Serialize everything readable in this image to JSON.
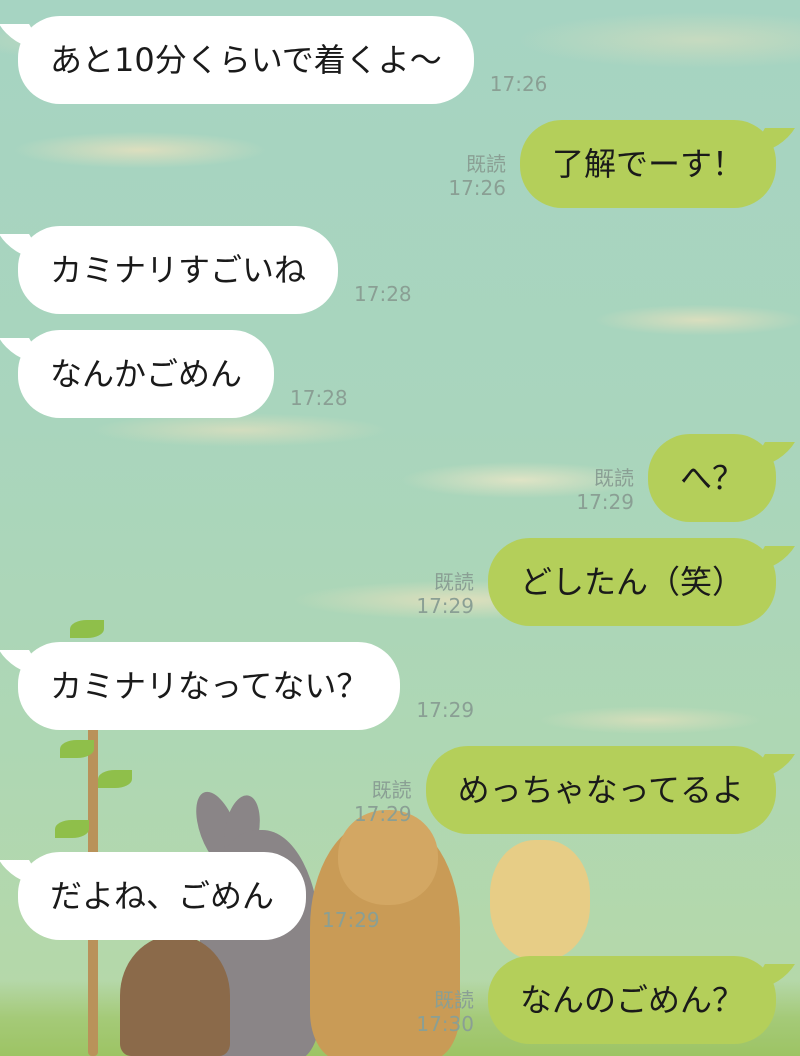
{
  "chat": {
    "messages": [
      {
        "side": "in",
        "text": "あと10分くらいで着くよ〜",
        "time": "17:26"
      },
      {
        "side": "out",
        "text": "了解でーす！",
        "time": "17:26",
        "read": "既読"
      },
      {
        "side": "in",
        "text": "カミナリすごいね",
        "time": "17:28"
      },
      {
        "side": "in",
        "text": "なんかごめん",
        "time": "17:28"
      },
      {
        "side": "out",
        "text": "へ？",
        "time": "17:29",
        "read": "既読"
      },
      {
        "side": "out",
        "text": "どしたん（笑）",
        "time": "17:29",
        "read": "既読"
      },
      {
        "side": "in",
        "text": "カミナリなってない？",
        "time": "17:29"
      },
      {
        "side": "out",
        "text": "めっちゃなってるよ",
        "time": "17:29",
        "read": "既読"
      },
      {
        "side": "in",
        "text": "だよね、ごめん",
        "time": "17:29"
      },
      {
        "side": "out",
        "text": "なんのごめん？",
        "time": "17:30",
        "read": "既読"
      }
    ]
  },
  "colors": {
    "incoming_bubble": "#ffffff",
    "outgoing_bubble": "#b4cf5a",
    "meta_text": "#8a9f94"
  }
}
